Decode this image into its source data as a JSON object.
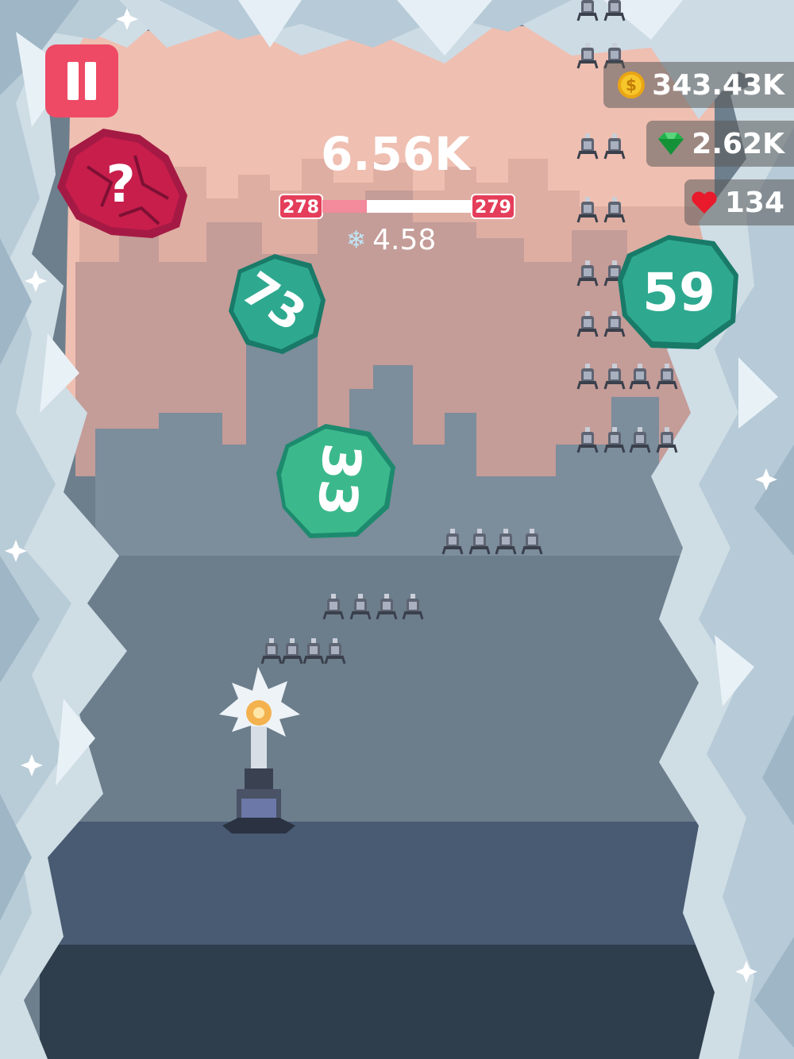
{
  "hud": {
    "coins": "343.43K",
    "gems": "2.62K",
    "lives": "134",
    "score": "6.56K",
    "level_current": "278",
    "level_next": "279",
    "level_progress": 0.3,
    "freeze_timer": "4.58"
  },
  "rocks": [
    {
      "label": "?",
      "kind": "mystery",
      "color": "#c81e4c"
    },
    {
      "label": "73",
      "kind": "normal",
      "color": "#2ea98f"
    },
    {
      "label": "59",
      "kind": "normal",
      "color": "#2ea98f"
    },
    {
      "label": "33",
      "kind": "normal",
      "color": "#2ea98f"
    }
  ],
  "icons": {
    "pause": "pause-icon",
    "coin": "coin-icon",
    "gem": "gem-icon",
    "heart": "heart-icon",
    "snowflake": "snowflake-icon"
  },
  "colors": {
    "accent": "#ee4a65",
    "rock_green": "#2ea98f",
    "rock_red": "#c81e4c",
    "sky_pink": "#efc1b4",
    "ground": "#2f3e4d"
  }
}
